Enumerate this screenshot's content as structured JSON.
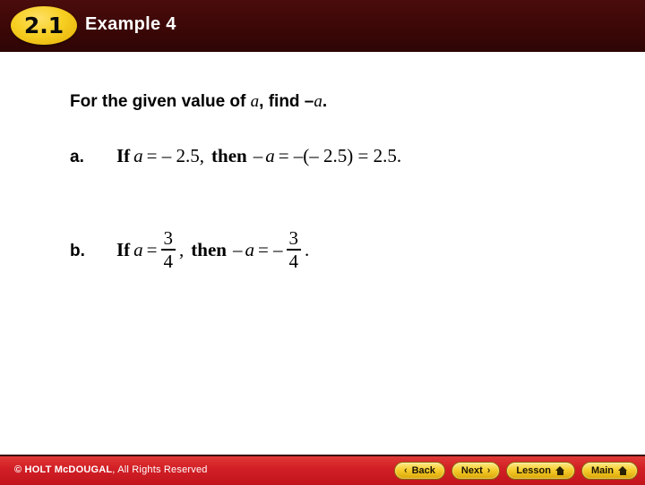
{
  "header": {
    "badge": "2.1",
    "title": "Example 4"
  },
  "content": {
    "prompt": {
      "before": "For the given value of ",
      "var1": "a",
      "middle": ", find –",
      "var2": "a",
      "after": "."
    },
    "items": [
      {
        "label": "a.",
        "parts": {
          "if": "If",
          "var1": "a",
          "eq1": "= – 2.5,",
          "then": "then",
          "neg1": "–",
          "var2": "a",
          "eq2": "= –(– 2.5) = 2.5."
        }
      },
      {
        "label": "b.",
        "parts": {
          "if": "If",
          "var1": "a",
          "eq1": "=",
          "frac1_num": "3",
          "frac1_den": "4",
          "comma": ",",
          "then": "then",
          "neg1": "–",
          "var2": "a",
          "eq2": "= –",
          "frac2_num": "3",
          "frac2_den": "4",
          "period": "."
        }
      }
    ]
  },
  "footer": {
    "copyright_strong": "© HOLT McDOUGAL",
    "copyright_rest": ", All Rights Reserved",
    "buttons": [
      {
        "label": "Back",
        "icon": "chevron-left",
        "glyph": "‹"
      },
      {
        "label": "Next",
        "icon": "chevron-right",
        "glyph": "›"
      },
      {
        "label": "Lesson",
        "icon": "home"
      },
      {
        "label": "Main",
        "icon": "home"
      }
    ]
  },
  "colors": {
    "header_bg": "#3c0707",
    "badge_gold": "#f7cf23",
    "footer_red": "#d32027",
    "body_bg": "#ffffff",
    "text": "#000000"
  }
}
